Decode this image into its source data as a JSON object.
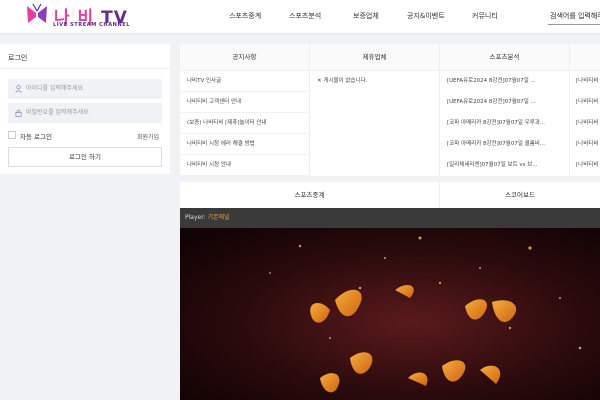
{
  "header": {
    "logo_name_a": "나 비",
    "logo_name_b": "TV",
    "logo_tagline": "LIVE STREAM CHANNEL",
    "nav": [
      "스포츠중계",
      "스포츠분석",
      "보증업체",
      "공지&이벤트",
      "커뮤니티"
    ],
    "search_text": "검색어를 입력해주"
  },
  "login": {
    "title": "로그인",
    "id_placeholder": "아이디를 입력해주세요",
    "pw_placeholder": "비밀번호를 입력해주세요",
    "remember_label": "자동 로그인",
    "signup_link": "회원가입",
    "login_button": "로그인 하기"
  },
  "board": {
    "columns": [
      {
        "title": "공지사항",
        "rows": [
          "나비TV 인사글",
          "나비티비 고객센터 안내",
          "(보증) 나비티비 [제휴]놀이터 안내",
          "나비티비 시청 에러 해결 방법",
          "나비티비 시청 안내"
        ]
      },
      {
        "title": "제휴업체",
        "rows": [
          "✕ 게시물이 없습니다."
        ]
      },
      {
        "title": "스포츠분석",
        "rows": [
          "[UEFA유로2024 8강전]07월07일 ...",
          "[UEFA유로2024 8강전]07월07일 ...",
          "[코파 아메리카 8강전]07월07일 우루과...",
          "[코파 아메리카 8강전]07월07일 콜롬비...",
          "[일리체세리엔]07월07일 보트 vs 브..."
        ]
      },
      {
        "title": "",
        "rows": [
          "[나비티비",
          "[나비티비",
          "[나비티비",
          "[나비티비",
          "[나비티비"
        ]
      }
    ]
  },
  "tabs": [
    "스포츠중계",
    "스코어보드"
  ],
  "player": {
    "label": "Player:",
    "channel": "기본채널"
  },
  "colors": {
    "brand_purple": "#6b2b8e",
    "brand_pink": "#e040a0",
    "channel_orange": "#f0a030"
  }
}
